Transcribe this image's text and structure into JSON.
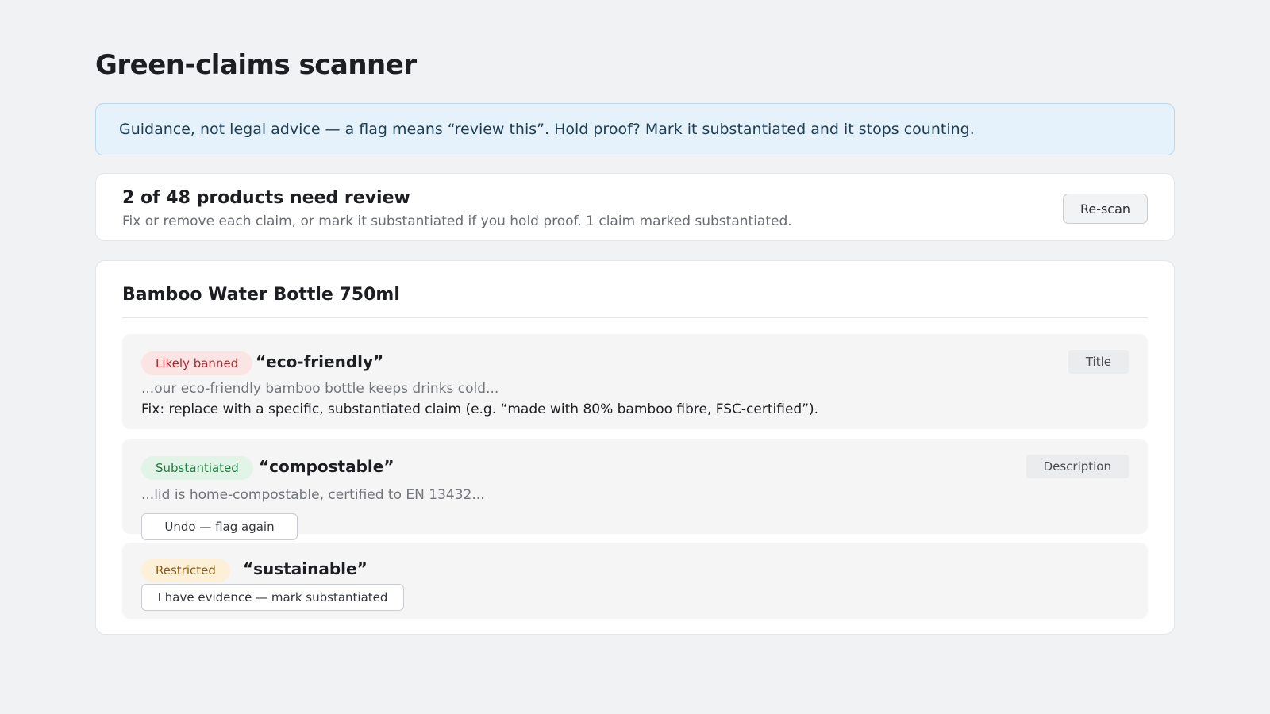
{
  "page": {
    "title": "Green-claims scanner"
  },
  "notice": {
    "text": "Guidance, not legal advice — a flag means “review this”. Hold proof? Mark it substantiated and it stops counting."
  },
  "summary": {
    "heading": "2 of 48 products need review",
    "subtext": "Fix or remove each claim, or mark it substantiated if you hold proof. 1 claim marked substantiated.",
    "rescan_label": "Re-scan"
  },
  "product": {
    "name": "Bamboo Water Bottle 750ml",
    "claims": [
      {
        "status": "Likely banned",
        "term": "“eco-friendly”",
        "location": "Title",
        "context": "...our eco-friendly bamboo bottle keeps drinks cold...",
        "fix": "Fix: replace with a specific, substantiated claim (e.g. “made with 80% bamboo fibre, FSC-certified”)."
      },
      {
        "status": "Substantiated",
        "term": "“compostable”",
        "location": "Description",
        "context": "...lid is home-compostable, certified to EN 13432...",
        "action_label": "Undo — flag again"
      },
      {
        "status": "Restricted",
        "term": "“sustainable”",
        "action_label": "I have evidence — mark substantiated"
      }
    ]
  },
  "colors": {
    "banned": "#b3262d",
    "substantiated": "#1f7a3c",
    "restricted": "#8a5d14",
    "notice_bg": "#e6f2fb"
  }
}
